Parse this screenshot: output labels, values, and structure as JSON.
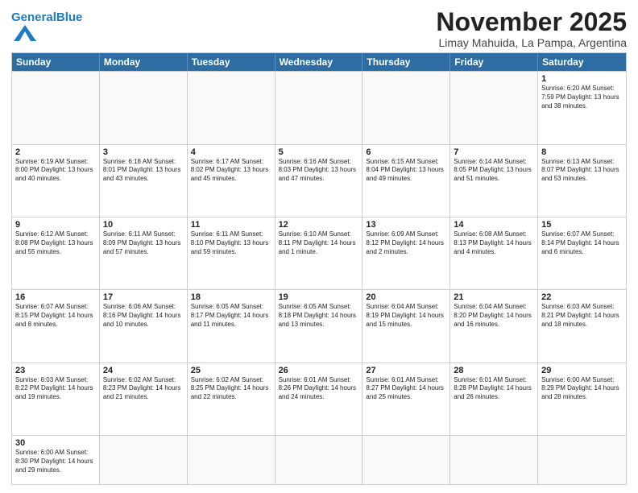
{
  "header": {
    "logo_general": "General",
    "logo_blue": "Blue",
    "month_title": "November 2025",
    "subtitle": "Limay Mahuida, La Pampa, Argentina"
  },
  "weekdays": [
    "Sunday",
    "Monday",
    "Tuesday",
    "Wednesday",
    "Thursday",
    "Friday",
    "Saturday"
  ],
  "rows": [
    [
      {
        "day": "",
        "info": ""
      },
      {
        "day": "",
        "info": ""
      },
      {
        "day": "",
        "info": ""
      },
      {
        "day": "",
        "info": ""
      },
      {
        "day": "",
        "info": ""
      },
      {
        "day": "",
        "info": ""
      },
      {
        "day": "1",
        "info": "Sunrise: 6:20 AM\nSunset: 7:59 PM\nDaylight: 13 hours and 38 minutes."
      }
    ],
    [
      {
        "day": "2",
        "info": "Sunrise: 6:19 AM\nSunset: 8:00 PM\nDaylight: 13 hours and 40 minutes."
      },
      {
        "day": "3",
        "info": "Sunrise: 6:18 AM\nSunset: 8:01 PM\nDaylight: 13 hours and 43 minutes."
      },
      {
        "day": "4",
        "info": "Sunrise: 6:17 AM\nSunset: 8:02 PM\nDaylight: 13 hours and 45 minutes."
      },
      {
        "day": "5",
        "info": "Sunrise: 6:16 AM\nSunset: 8:03 PM\nDaylight: 13 hours and 47 minutes."
      },
      {
        "day": "6",
        "info": "Sunrise: 6:15 AM\nSunset: 8:04 PM\nDaylight: 13 hours and 49 minutes."
      },
      {
        "day": "7",
        "info": "Sunrise: 6:14 AM\nSunset: 8:05 PM\nDaylight: 13 hours and 51 minutes."
      },
      {
        "day": "8",
        "info": "Sunrise: 6:13 AM\nSunset: 8:07 PM\nDaylight: 13 hours and 53 minutes."
      }
    ],
    [
      {
        "day": "9",
        "info": "Sunrise: 6:12 AM\nSunset: 8:08 PM\nDaylight: 13 hours and 55 minutes."
      },
      {
        "day": "10",
        "info": "Sunrise: 6:11 AM\nSunset: 8:09 PM\nDaylight: 13 hours and 57 minutes."
      },
      {
        "day": "11",
        "info": "Sunrise: 6:11 AM\nSunset: 8:10 PM\nDaylight: 13 hours and 59 minutes."
      },
      {
        "day": "12",
        "info": "Sunrise: 6:10 AM\nSunset: 8:11 PM\nDaylight: 14 hours and 1 minute."
      },
      {
        "day": "13",
        "info": "Sunrise: 6:09 AM\nSunset: 8:12 PM\nDaylight: 14 hours and 2 minutes."
      },
      {
        "day": "14",
        "info": "Sunrise: 6:08 AM\nSunset: 8:13 PM\nDaylight: 14 hours and 4 minutes."
      },
      {
        "day": "15",
        "info": "Sunrise: 6:07 AM\nSunset: 8:14 PM\nDaylight: 14 hours and 6 minutes."
      }
    ],
    [
      {
        "day": "16",
        "info": "Sunrise: 6:07 AM\nSunset: 8:15 PM\nDaylight: 14 hours and 8 minutes."
      },
      {
        "day": "17",
        "info": "Sunrise: 6:06 AM\nSunset: 8:16 PM\nDaylight: 14 hours and 10 minutes."
      },
      {
        "day": "18",
        "info": "Sunrise: 6:05 AM\nSunset: 8:17 PM\nDaylight: 14 hours and 11 minutes."
      },
      {
        "day": "19",
        "info": "Sunrise: 6:05 AM\nSunset: 8:18 PM\nDaylight: 14 hours and 13 minutes."
      },
      {
        "day": "20",
        "info": "Sunrise: 6:04 AM\nSunset: 8:19 PM\nDaylight: 14 hours and 15 minutes."
      },
      {
        "day": "21",
        "info": "Sunrise: 6:04 AM\nSunset: 8:20 PM\nDaylight: 14 hours and 16 minutes."
      },
      {
        "day": "22",
        "info": "Sunrise: 6:03 AM\nSunset: 8:21 PM\nDaylight: 14 hours and 18 minutes."
      }
    ],
    [
      {
        "day": "23",
        "info": "Sunrise: 6:03 AM\nSunset: 8:22 PM\nDaylight: 14 hours and 19 minutes."
      },
      {
        "day": "24",
        "info": "Sunrise: 6:02 AM\nSunset: 8:23 PM\nDaylight: 14 hours and 21 minutes."
      },
      {
        "day": "25",
        "info": "Sunrise: 6:02 AM\nSunset: 8:25 PM\nDaylight: 14 hours and 22 minutes."
      },
      {
        "day": "26",
        "info": "Sunrise: 6:01 AM\nSunset: 8:26 PM\nDaylight: 14 hours and 24 minutes."
      },
      {
        "day": "27",
        "info": "Sunrise: 6:01 AM\nSunset: 8:27 PM\nDaylight: 14 hours and 25 minutes."
      },
      {
        "day": "28",
        "info": "Sunrise: 6:01 AM\nSunset: 8:28 PM\nDaylight: 14 hours and 26 minutes."
      },
      {
        "day": "29",
        "info": "Sunrise: 6:00 AM\nSunset: 8:29 PM\nDaylight: 14 hours and 28 minutes."
      }
    ],
    [
      {
        "day": "30",
        "info": "Sunrise: 6:00 AM\nSunset: 8:30 PM\nDaylight: 14 hours and 29 minutes."
      },
      {
        "day": "",
        "info": ""
      },
      {
        "day": "",
        "info": ""
      },
      {
        "day": "",
        "info": ""
      },
      {
        "day": "",
        "info": ""
      },
      {
        "day": "",
        "info": ""
      },
      {
        "day": "",
        "info": ""
      }
    ]
  ]
}
